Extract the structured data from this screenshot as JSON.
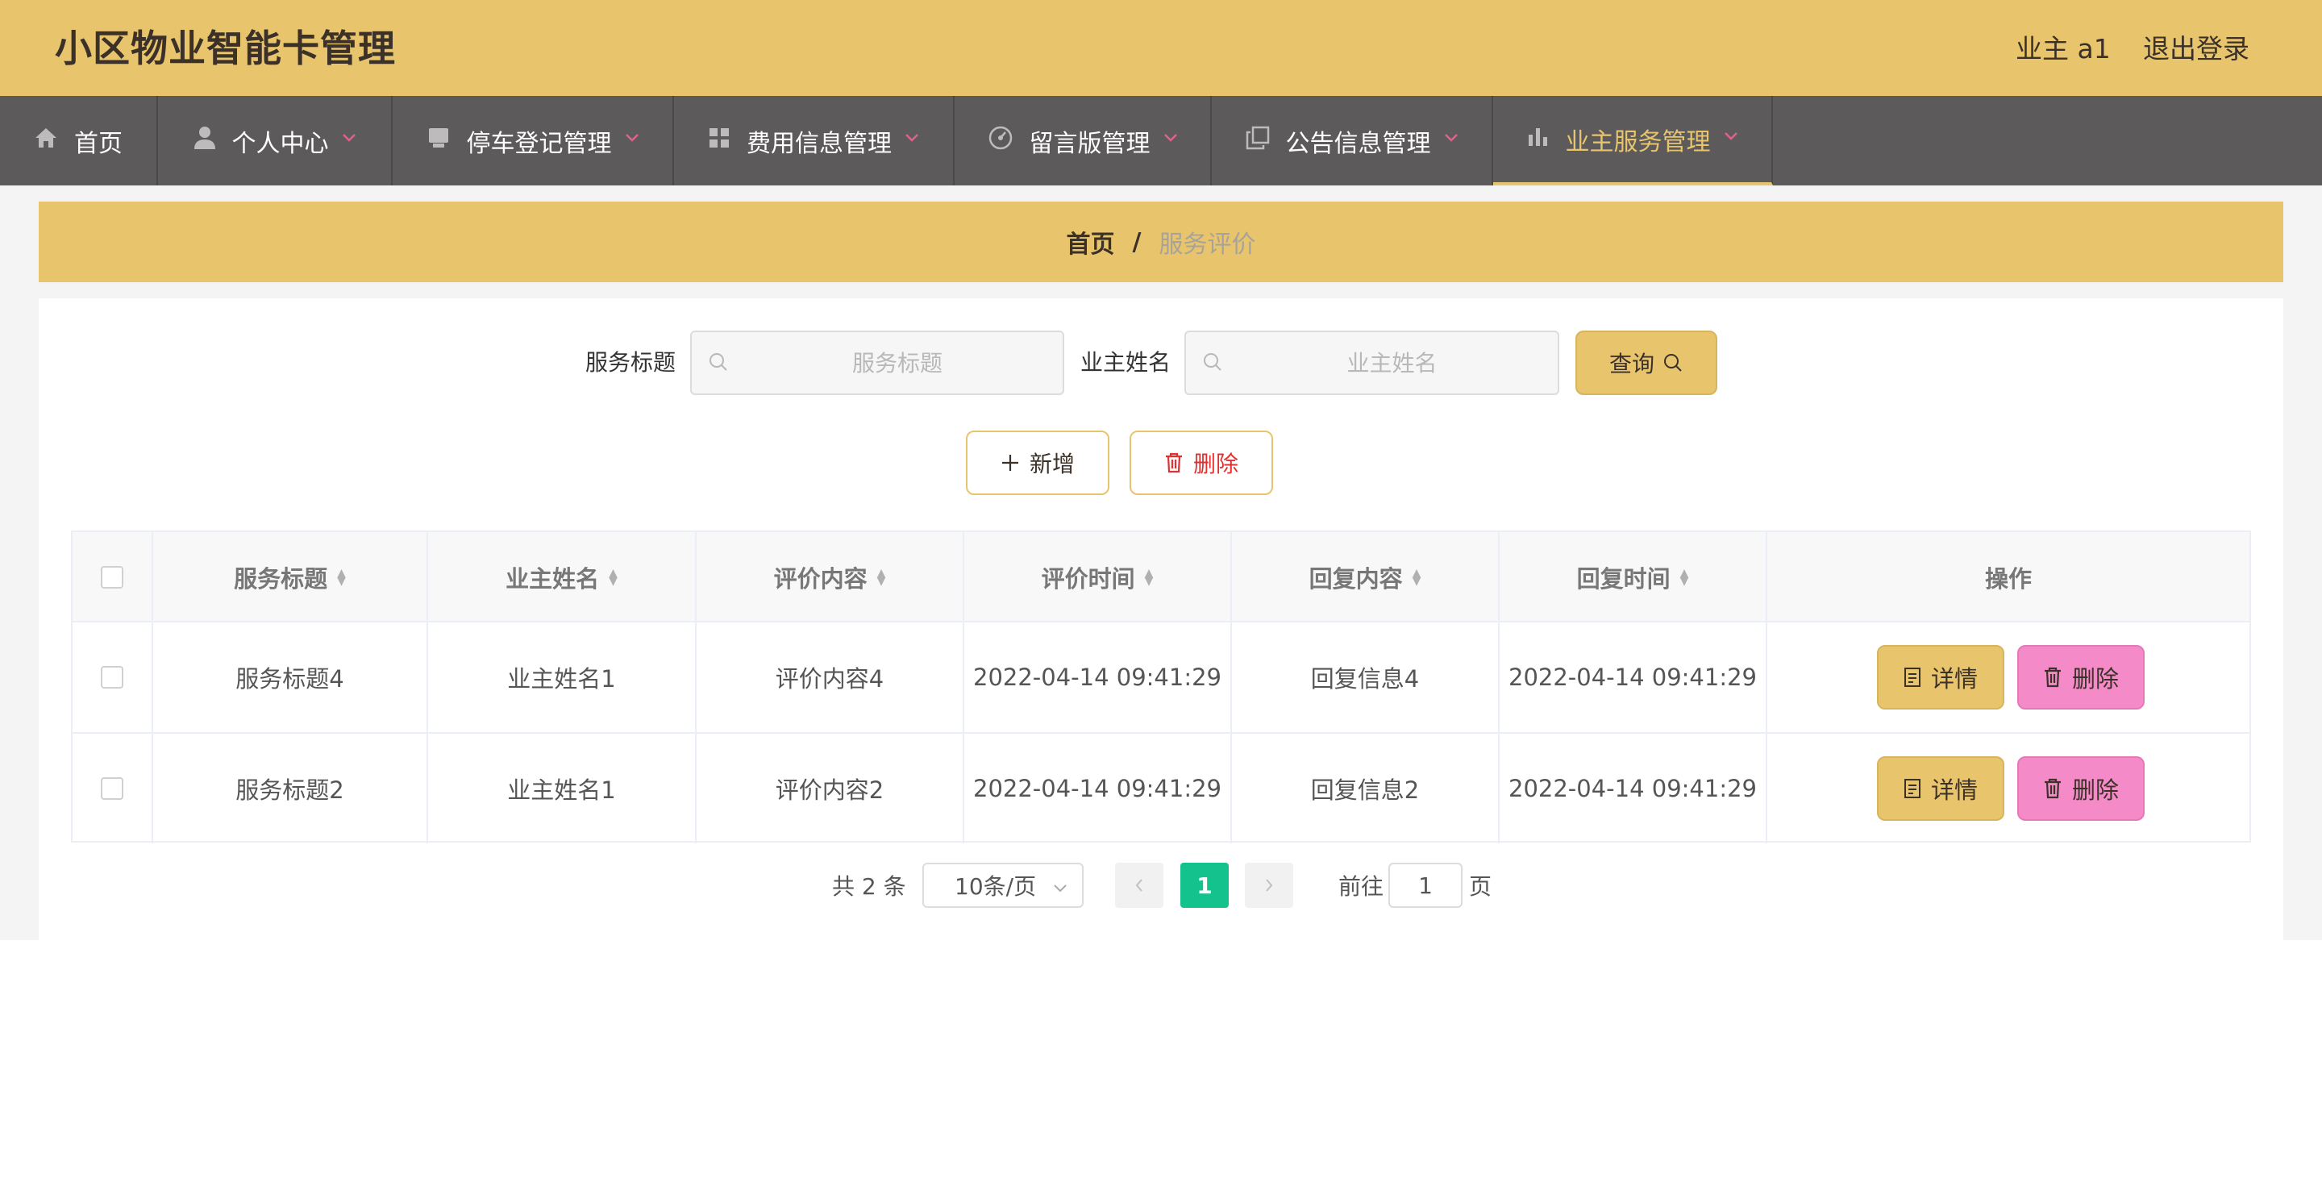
{
  "header": {
    "app_title": "小区物业智能卡管理",
    "user_label": "业主 a1",
    "logout_label": "退出登录"
  },
  "nav": {
    "items": [
      {
        "label": "首页",
        "icon": "home-icon"
      },
      {
        "label": "个人中心",
        "icon": "user-icon"
      },
      {
        "label": "停车登记管理",
        "icon": "box-icon"
      },
      {
        "label": "费用信息管理",
        "icon": "grid-icon"
      },
      {
        "label": "留言版管理",
        "icon": "gauge-icon"
      },
      {
        "label": "公告信息管理",
        "icon": "copy-icon"
      },
      {
        "label": "业主服务管理",
        "icon": "bar-chart-icon",
        "active": true
      }
    ]
  },
  "breadcrumb": {
    "home": "首页",
    "separator": "/",
    "current": "服务评价"
  },
  "search": {
    "title_label": "服务标题",
    "title_placeholder": "服务标题",
    "owner_label": "业主姓名",
    "owner_placeholder": "业主姓名",
    "query_label": "查询"
  },
  "actions": {
    "add_label": "新增",
    "delete_label": "删除"
  },
  "table": {
    "headers": [
      "服务标题",
      "业主姓名",
      "评价内容",
      "评价时间",
      "回复内容",
      "回复时间",
      "操作"
    ],
    "rows": [
      [
        "服务标题4",
        "业主姓名1",
        "评价内容4",
        "2022-04-14 09:41:29",
        "回复信息4",
        "2022-04-14 09:41:29"
      ],
      [
        "服务标题2",
        "业主姓名1",
        "评价内容2",
        "2022-04-14 09:41:29",
        "回复信息2",
        "2022-04-14 09:41:29"
      ]
    ],
    "detail_label": "详情",
    "remove_label": "删除"
  },
  "pagination": {
    "total": "共 2 条",
    "page_size": "10条/页",
    "current_page": "1",
    "goto_label": "前往",
    "goto_value": "1",
    "page_suffix": "页"
  },
  "colors": {
    "accent": "#e8c56d",
    "nav_bg": "#5c5a5b",
    "pager_active": "#13c28d",
    "delete_pink": "#f58ac8"
  }
}
